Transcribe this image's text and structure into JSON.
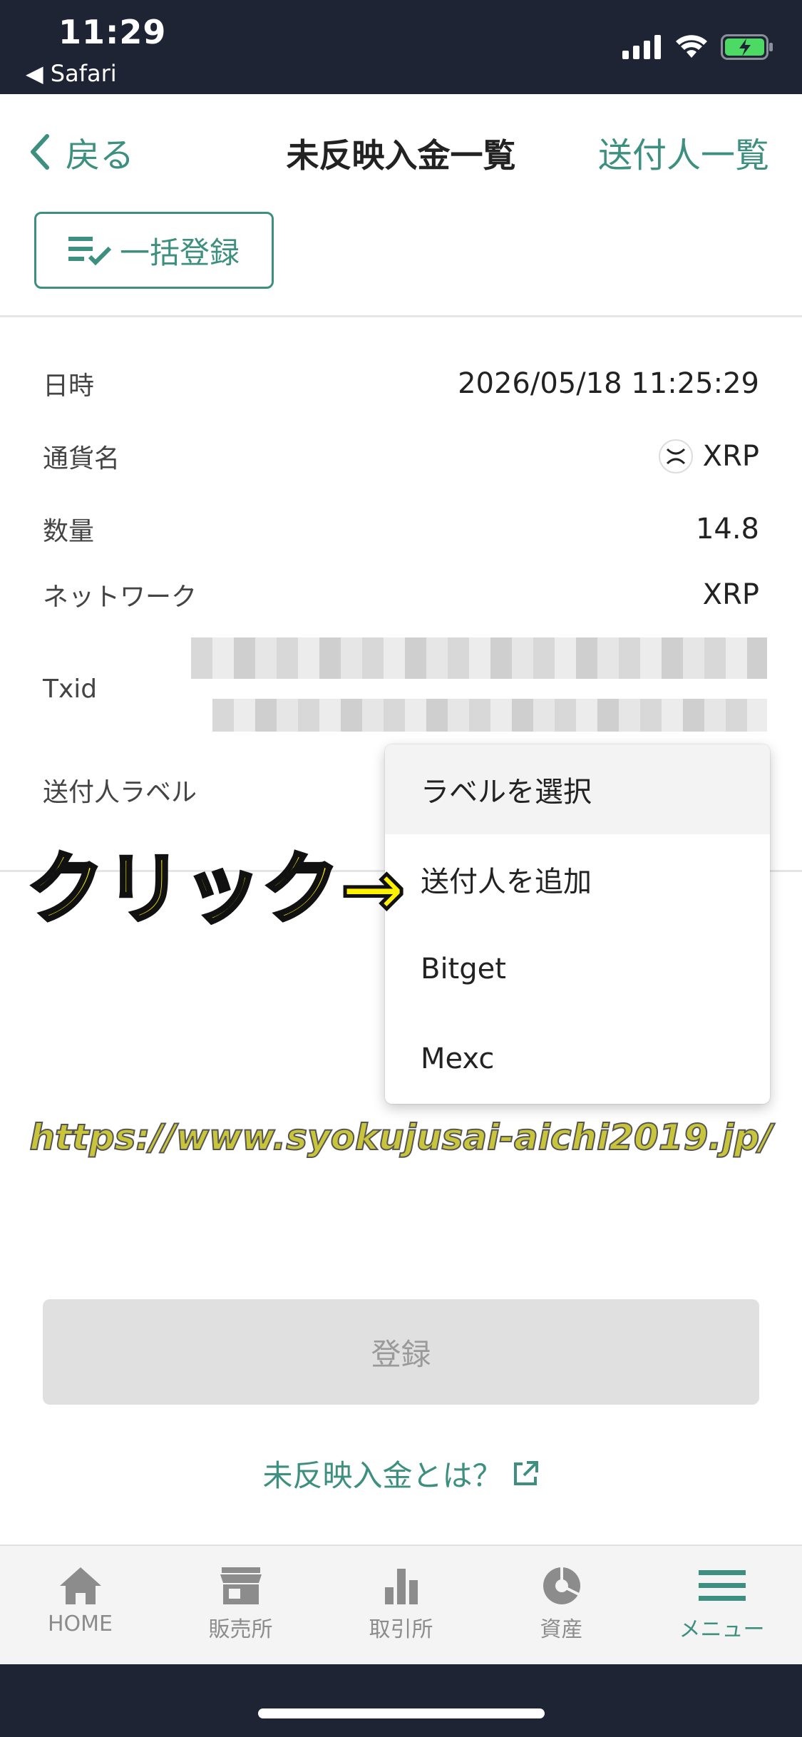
{
  "status_bar": {
    "time": "11:29",
    "back_app": "◀ Safari"
  },
  "nav": {
    "back_label": "戻る",
    "title": "未反映入金一覧",
    "right_label": "送付人一覧"
  },
  "bulk_button": {
    "label": "一括登録"
  },
  "details": {
    "datetime": {
      "label": "日時",
      "value": "2026/05/18 11:25:29"
    },
    "currency": {
      "label": "通貨名",
      "value": "XRP"
    },
    "quantity": {
      "label": "数量",
      "value": "14.8"
    },
    "network": {
      "label": "ネットワーク",
      "value": "XRP"
    },
    "txid": {
      "label": "Txid"
    },
    "sender_label": {
      "label": "送付人ラベル"
    }
  },
  "dropdown": {
    "items": [
      "ラベルを選択",
      "送付人を追加",
      "Bitget",
      "Mexc"
    ]
  },
  "annotation": {
    "text": "クリック→"
  },
  "watermark": {
    "text": "https://www.syokujusai-aichi2019.jp/"
  },
  "register_button": {
    "label": "登録"
  },
  "info_link": {
    "label": "未反映入金とは？"
  },
  "tabs": [
    {
      "label": "HOME",
      "icon": "home-icon"
    },
    {
      "label": "販売所",
      "icon": "store-icon"
    },
    {
      "label": "取引所",
      "icon": "bar-chart-icon"
    },
    {
      "label": "資産",
      "icon": "pie-chart-icon"
    },
    {
      "label": "メニュー",
      "icon": "menu-icon",
      "active": true
    }
  ],
  "colors": {
    "accent": "#3d8f7f",
    "status_bar": "#1e2433",
    "annotation": "#fff200"
  }
}
